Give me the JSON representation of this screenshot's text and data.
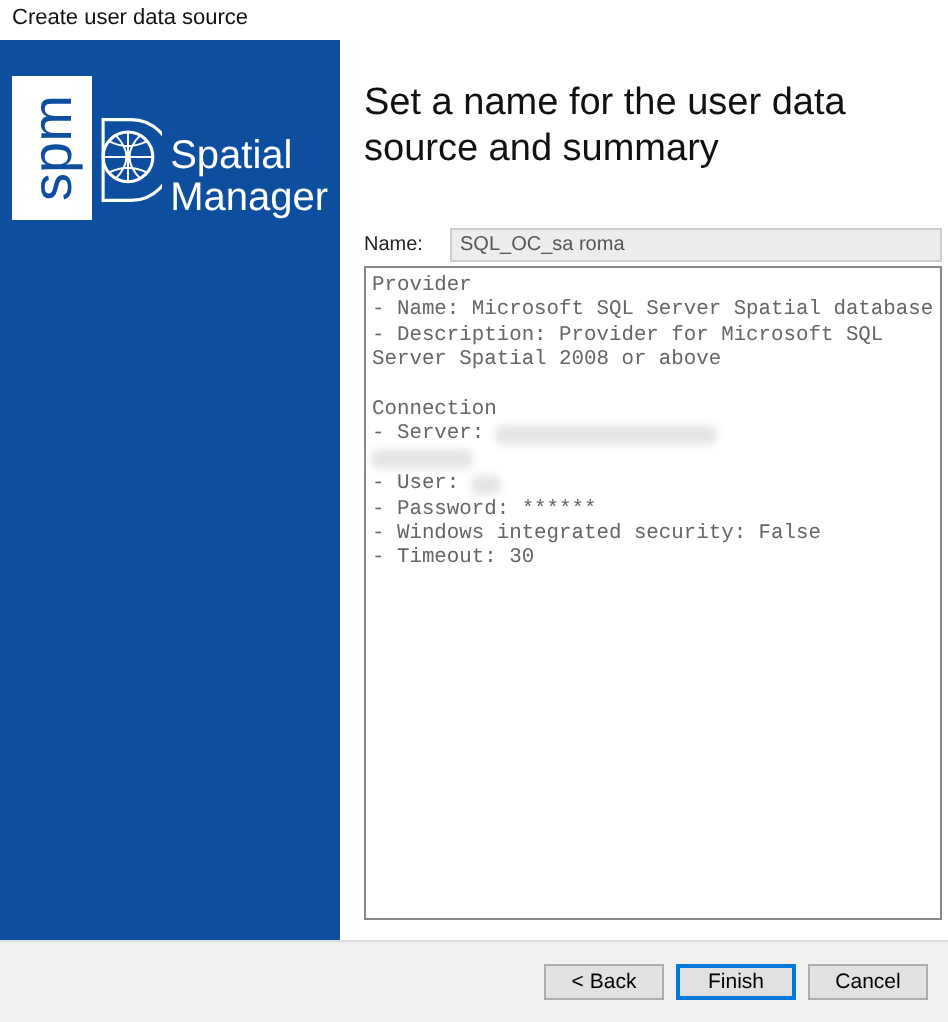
{
  "window": {
    "title": "Create user data source"
  },
  "brand": {
    "mark": "spm",
    "name_line1": "Spatial",
    "name_line2": "Manager"
  },
  "heading": "Set a name for the user data source and summary",
  "name_field": {
    "label": "Name:",
    "value": "SQL_OC_sa roma",
    "disabled": true
  },
  "summary": [
    {
      "kind": "text",
      "text": "Provider"
    },
    {
      "kind": "text",
      "text": "- Name: Microsoft SQL Server Spatial database"
    },
    {
      "kind": "text",
      "text": "- Description: Provider for Microsoft SQL"
    },
    {
      "kind": "text",
      "text": "Server Spatial 2008 or above"
    },
    {
      "kind": "blank"
    },
    {
      "kind": "text",
      "text": "Connection"
    },
    {
      "kind": "redacted",
      "text": "- Server:"
    },
    {
      "kind": "redacted_line"
    },
    {
      "kind": "redacted",
      "text": "- User:"
    },
    {
      "kind": "text",
      "text": "- Password: ******"
    },
    {
      "kind": "text",
      "text": "- Windows integrated security: False"
    },
    {
      "kind": "text",
      "text": "- Timeout: 30"
    }
  ],
  "buttons": [
    {
      "label": "< Back",
      "focused": false
    },
    {
      "label": "Finish",
      "focused": true
    },
    {
      "label": "Cancel",
      "focused": false
    }
  ]
}
